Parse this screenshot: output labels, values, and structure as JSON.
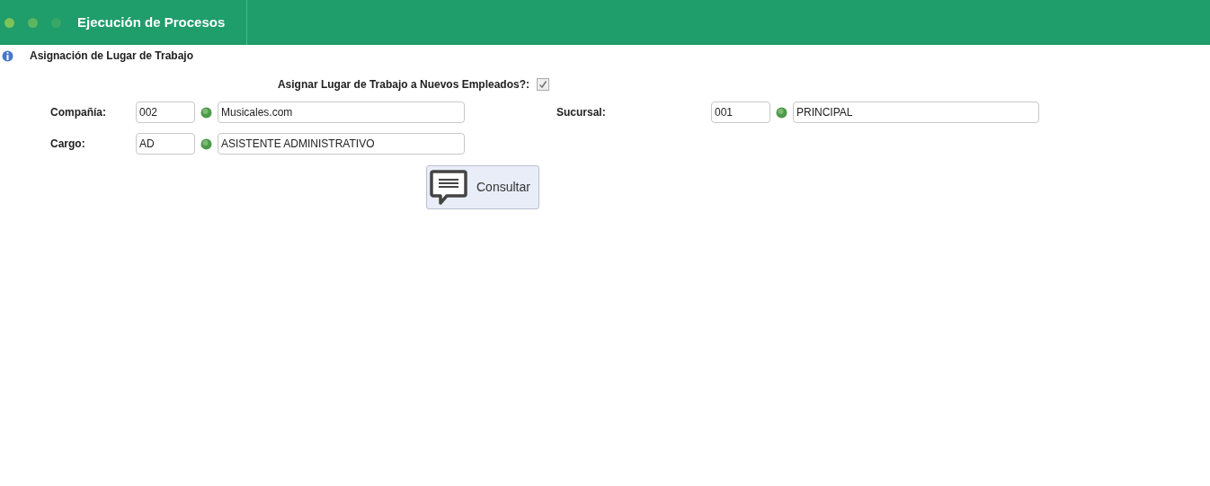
{
  "header": {
    "title": "Ejecución de Procesos"
  },
  "section": {
    "title": "Asignación de Lugar de Trabajo"
  },
  "assign_option": {
    "label": "Asignar Lugar de Trabajo a Nuevos Empleados?:",
    "checked": true
  },
  "field_rows": [
    [
      {
        "label": "Compañía:",
        "code": "002",
        "name": "Musicales.com"
      },
      {
        "label": "Sucursal:",
        "code": "001",
        "name": "PRINCIPAL"
      }
    ],
    [
      {
        "label": "Cargo:",
        "code": "AD",
        "name": "ASISTENTE ADMINISTRATIVO"
      }
    ]
  ],
  "button": {
    "label": "Consultar"
  }
}
